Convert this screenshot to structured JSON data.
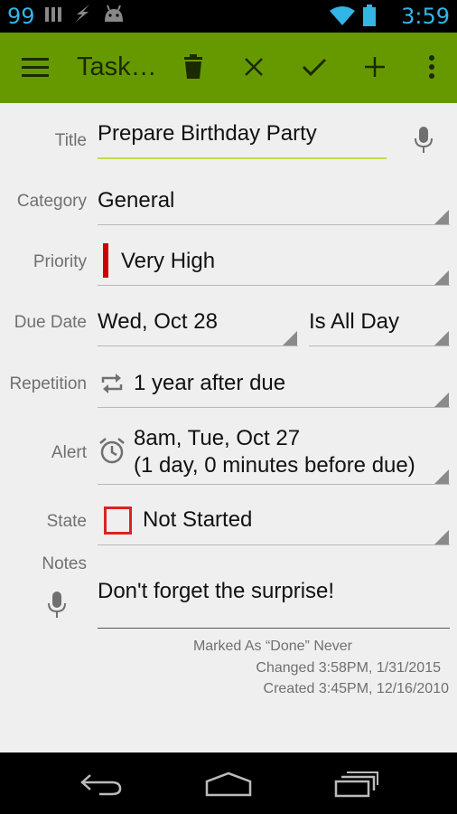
{
  "status_bar": {
    "notification_count": "99",
    "time": "3:59",
    "icons": [
      "signal-bars-icon",
      "lightning-icon",
      "android-icon",
      "wifi-icon",
      "battery-icon"
    ]
  },
  "action_bar": {
    "title": "Task…",
    "background": "#669900",
    "actions": [
      "menu-icon",
      "trash-icon",
      "close-icon",
      "check-icon",
      "add-icon",
      "overflow-icon"
    ]
  },
  "form": {
    "title": {
      "label": "Title",
      "value": "Prepare Birthday Party"
    },
    "category": {
      "label": "Category",
      "value": "General"
    },
    "priority": {
      "label": "Priority",
      "value": "Very High",
      "color": "#cc0000"
    },
    "due_date": {
      "label": "Due Date",
      "date": "Wed, Oct 28",
      "time": "Is All Day"
    },
    "repetition": {
      "label": "Repetition",
      "value": "1 year after due"
    },
    "alert": {
      "label": "Alert",
      "line1": "8am, Tue, Oct 27",
      "line2": "(1 day, 0 minutes before due)"
    },
    "state": {
      "label": "State",
      "value": "Not Started",
      "color": "#dd2222"
    },
    "notes": {
      "label": "Notes",
      "value": "Don't forget the surprise!"
    }
  },
  "meta": {
    "marked": "Marked As “Done” Never",
    "changed": "Changed 3:58PM, 1/31/2015",
    "created": "Created 3:45PM, 12/16/2010"
  },
  "nav_bar": {
    "icons": [
      "back-icon",
      "home-icon",
      "recents-icon"
    ]
  }
}
